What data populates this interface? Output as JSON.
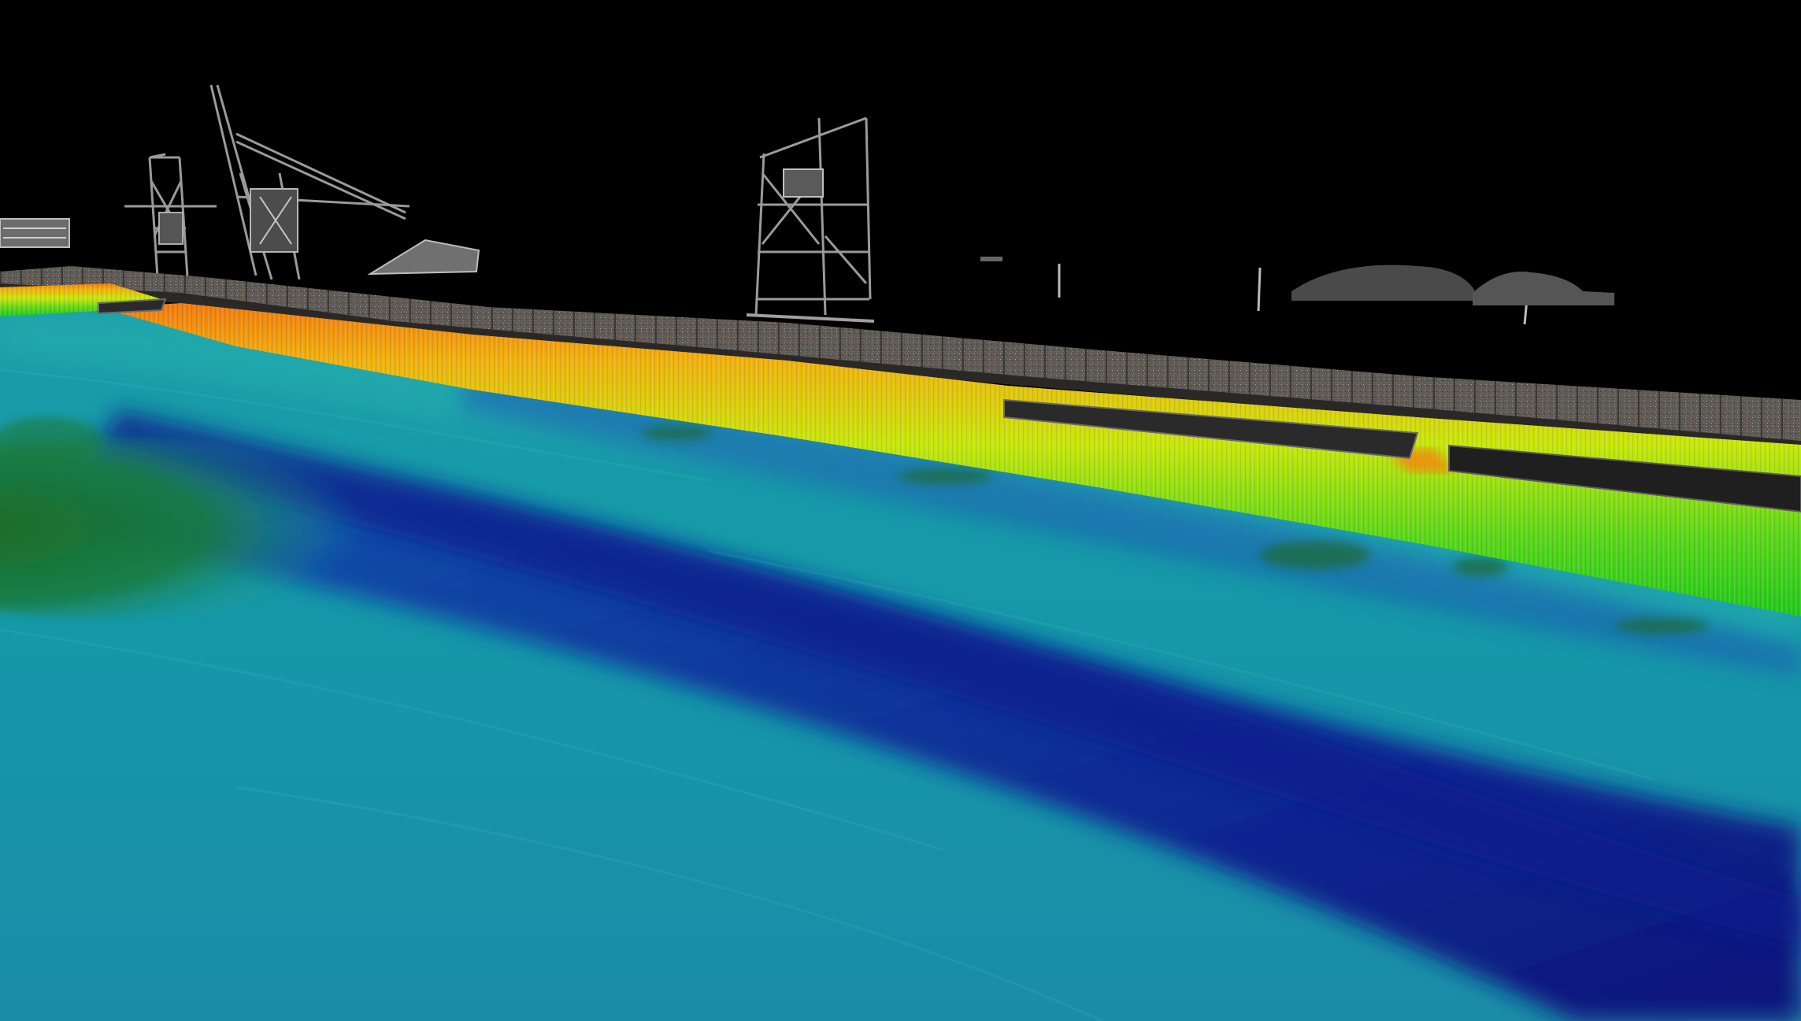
{
  "scene": {
    "kind": "multibeam-sonar-and-lidar-point-cloud",
    "colors": {
      "sky": "#000000",
      "deep_channel": "#0a1f8f",
      "seabed_mid": "#1aa0a8",
      "seabed_shallow": "#24b4a0",
      "wall_base": "#2fd11e",
      "wall_mid": "#c8e60c",
      "wall_top": "#f08a10",
      "lidar_gray": "#8a8a8a",
      "shoal_green": "#1a7a2a"
    },
    "icons": []
  }
}
